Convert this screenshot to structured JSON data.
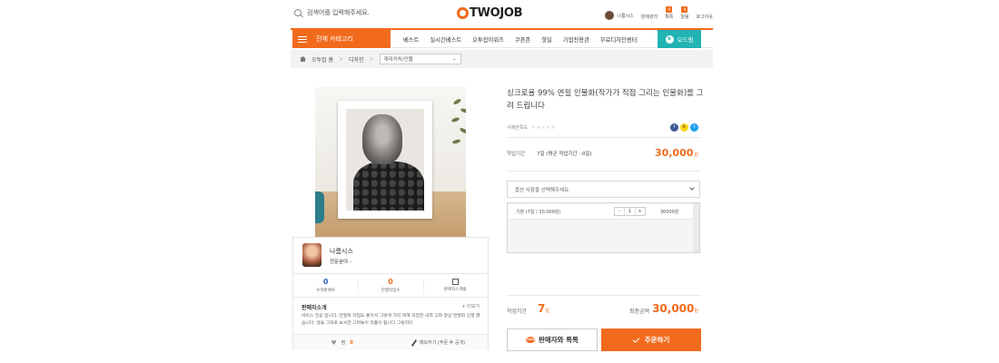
{
  "header": {
    "search_placeholder": "검색어를 입력해주세요.",
    "logo": "TWOJOB",
    "user_name": "나름시스",
    "links": [
      {
        "label": "판매관리",
        "badge": ""
      },
      {
        "label": "톡톡",
        "badge": "0"
      },
      {
        "label": "알림",
        "badge": "0"
      },
      {
        "label": "로그아웃",
        "badge": ""
      }
    ]
  },
  "nav": {
    "category_button": "전체 카테고리",
    "items": [
      "베스트",
      "실시간베스트",
      "오투잡이워즈",
      "쿠폰존",
      "핫딜",
      "기업전용관",
      "무료디자인센터"
    ],
    "odream": "오드림",
    "odream_icon_text": "b"
  },
  "breadcrumb": {
    "home": "오투잡 홈",
    "level1": "디자인",
    "level2": "캐리커처/인물"
  },
  "product": {
    "title": "싱크로율 99% 연필 인물화(작가가 직접 그리는 인물화)를 그려 드립니다",
    "rating_label": "구매만족도",
    "stars": "★★★★★",
    "work_period_label": "작업기간",
    "work_period_value": "7일 (평균 작업기간 : 0일)",
    "price": "30,000",
    "price_unit": "원",
    "option_placeholder": "옵션 사항을 선택해주세요.",
    "option_row": {
      "name": "기본 (7일 / 30,000원)",
      "minus": "-",
      "qty": "1",
      "plus": "+",
      "price": "30000원",
      "remove": "x"
    },
    "total_period_label": "작업기간",
    "total_period_value": "7",
    "total_period_unit": "일",
    "total_label": "최종금액",
    "total_price": "30,000",
    "total_unit": "원",
    "talk_button": "판매자와 톡톡",
    "talk_icon_text": "TALK",
    "order_button": "주문하기"
  },
  "seller": {
    "name": "나름시스",
    "specialty": "전문분야 -",
    "stats": [
      {
        "value": "0",
        "label": "누적판매수"
      },
      {
        "value": "0",
        "label": "진행작업수"
      },
      {
        "value": "",
        "label": "판매자스케줄"
      }
    ],
    "intro_title": "판매자소개",
    "intro_more": "+ 더보기",
    "intro_text": "서비스 전공 입니다. 연필화 작업도 좋아서 그렇게 가리 위해 작업한 내역 고화 항상 연필화 진행 했습니다. 생을 그대로 보시면 그려놓이 작품이 됩니다 그릴리티",
    "like_label": "찜",
    "like_count": "0",
    "memo_label": "메모하기 (주문 후 공개)"
  },
  "colors": {
    "accent": "#f26b1d",
    "teal": "#23b3b4",
    "blue": "#2f63b7"
  }
}
